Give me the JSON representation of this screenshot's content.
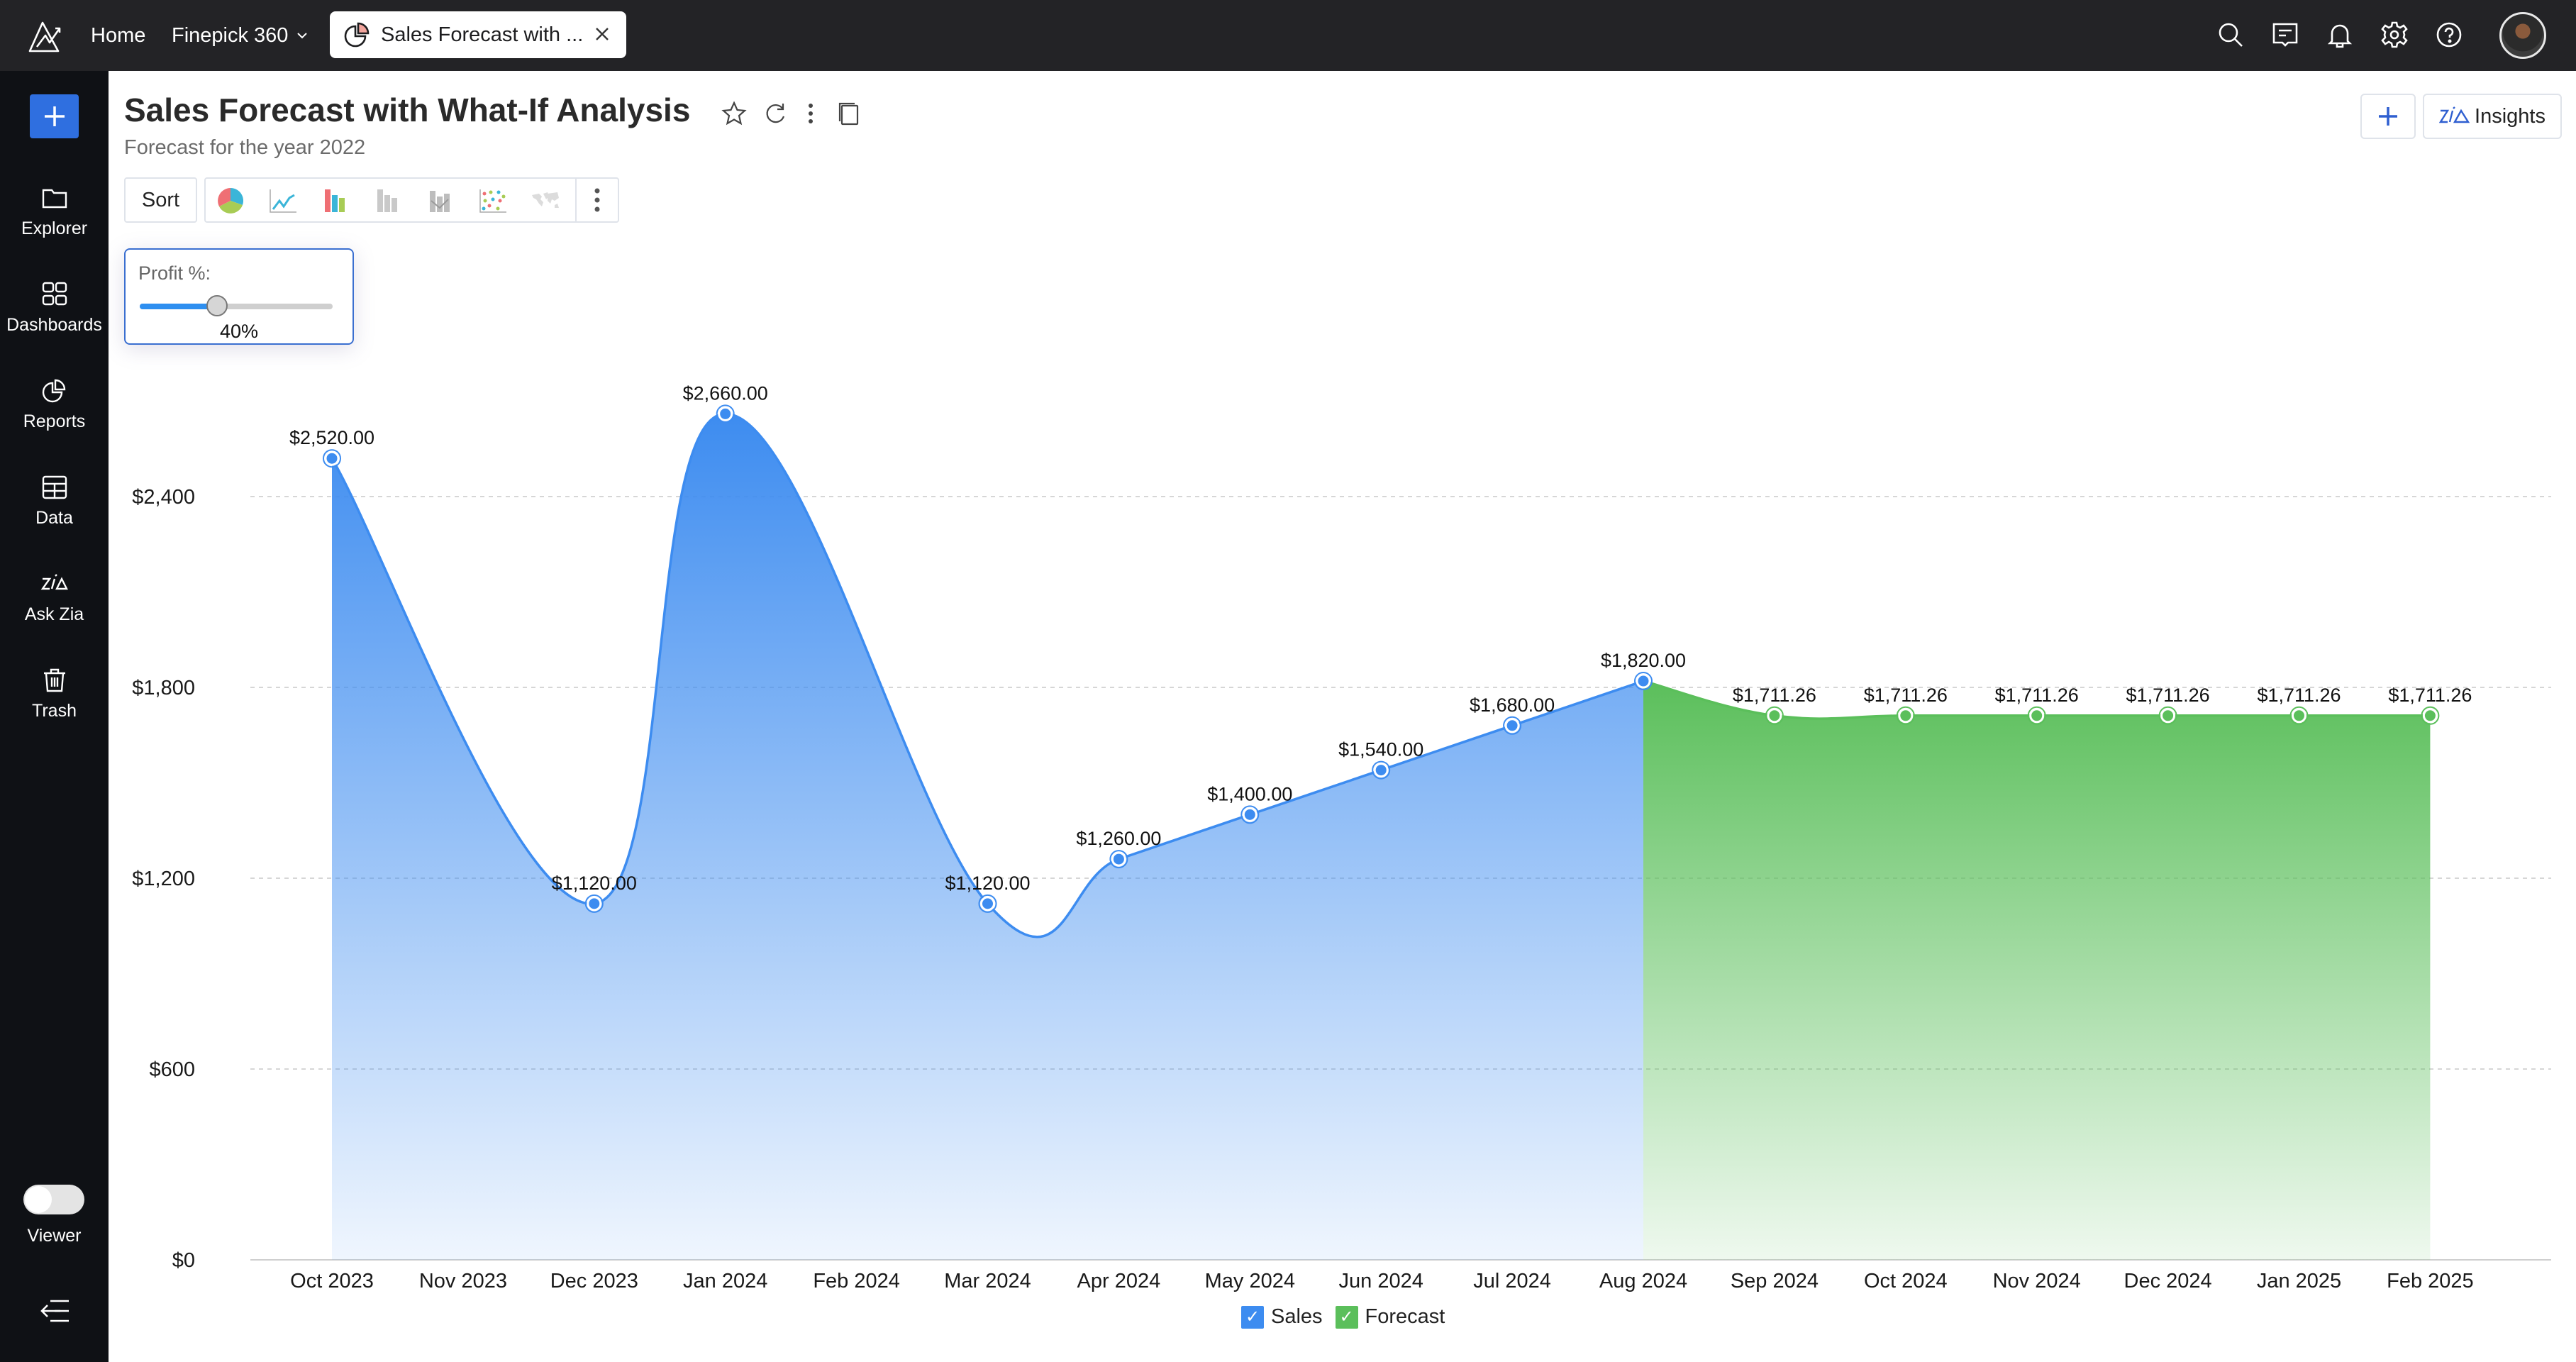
{
  "topbar": {
    "home": "Home",
    "workspace": "Finepick 360",
    "tab_title": "Sales Forecast with ...",
    "icons": [
      "search-icon",
      "comments-icon",
      "notifications-icon",
      "settings-icon",
      "help-icon"
    ]
  },
  "sidebar": {
    "items": [
      {
        "label": "Explorer",
        "icon": "folder-icon"
      },
      {
        "label": "Dashboards",
        "icon": "dashboards-icon"
      },
      {
        "label": "Reports",
        "icon": "reports-icon"
      },
      {
        "label": "Data",
        "icon": "table-icon"
      },
      {
        "label": "Ask Zia",
        "icon": "zia-icon"
      },
      {
        "label": "Trash",
        "icon": "trash-icon"
      }
    ],
    "mode_label": "Viewer"
  },
  "report": {
    "title": "Sales Forecast with What-If Analysis",
    "subtitle": "Forecast for the year 2022",
    "sort_label": "Sort",
    "insights_label": "Insights"
  },
  "whatif": {
    "label": "Profit %:",
    "value_text": "40%",
    "value_fraction": 0.4
  },
  "colors": {
    "sales": "#3d8cf0",
    "forecast": "#5bbf5b"
  },
  "chart_data": {
    "type": "area",
    "title": "",
    "xlabel": "",
    "ylabel": "",
    "categories": [
      "Oct 2023",
      "Nov 2023",
      "Dec 2023",
      "Jan 2024",
      "Feb 2024",
      "Mar 2024",
      "Apr 2024",
      "May 2024",
      "Jun 2024",
      "Jul 2024",
      "Aug 2024",
      "Sep 2024",
      "Oct 2024",
      "Nov 2024",
      "Dec 2024",
      "Jan 2025",
      "Feb 2025"
    ],
    "series": [
      {
        "name": "Sales",
        "values": [
          2520,
          null,
          1120,
          2660,
          null,
          1120,
          1260,
          1400,
          1540,
          1680,
          1820,
          null,
          null,
          null,
          null,
          null,
          null
        ],
        "labels": [
          "$2,520.00",
          "",
          "$1,120.00",
          "$2,660.00",
          "",
          "$1,120.00",
          "$1,260.00",
          "$1,400.00",
          "$1,540.00",
          "$1,680.00",
          "$1,820.00",
          "",
          "",
          "",
          "",
          "",
          ""
        ]
      },
      {
        "name": "Forecast",
        "values": [
          null,
          null,
          null,
          null,
          null,
          null,
          null,
          null,
          null,
          null,
          1820,
          1711.26,
          1711.26,
          1711.26,
          1711.26,
          1711.26,
          1711.26
        ],
        "labels": [
          "",
          "",
          "",
          "",
          "",
          "",
          "",
          "",
          "",
          "",
          "",
          "$1,711.26",
          "$1,711.26",
          "$1,711.26",
          "$1,711.26",
          "$1,711.26",
          "$1,711.26"
        ]
      }
    ],
    "y_ticks": [
      0,
      600,
      1200,
      1800,
      2400
    ],
    "y_tick_labels": [
      "$0",
      "$600",
      "$1,200",
      "$1,800",
      "$2,400"
    ],
    "ylim": [
      0,
      2400
    ],
    "grid": true,
    "legend": "bottom-center"
  }
}
